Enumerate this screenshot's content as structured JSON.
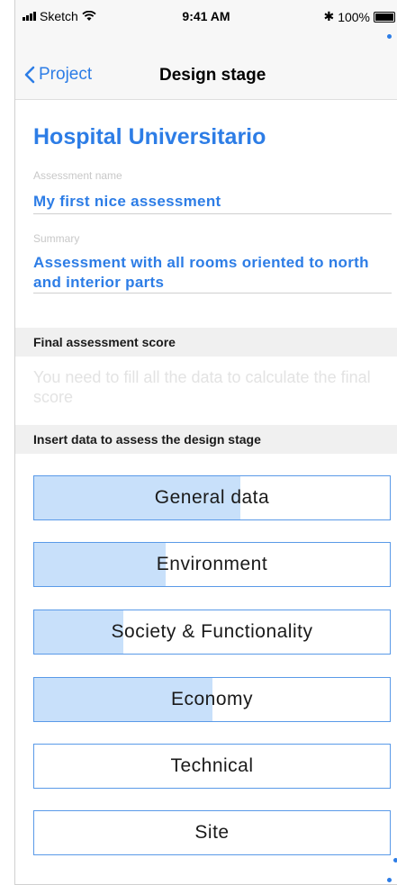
{
  "status_bar": {
    "carrier": "Sketch",
    "time": "9:41 AM",
    "bluetooth_symbol": "✱",
    "battery": "100%"
  },
  "nav": {
    "back_label": "Project",
    "title": "Design stage"
  },
  "project": {
    "name": "Hospital Universitario"
  },
  "fields": {
    "assessment_name_label": "Assessment name",
    "assessment_name_value": "My first nice assessment",
    "summary_label": "Summary",
    "summary_value": "Assessment with all rooms oriented to north and interior parts"
  },
  "sections": {
    "final_score_header": "Final assessment score",
    "final_score_placeholder": "You need to fill all the data to calculate the final score",
    "insert_data_header": "Insert data to assess the design stage"
  },
  "stages": [
    {
      "label": "General data",
      "progress": 0.58
    },
    {
      "label": "Environment",
      "progress": 0.37
    },
    {
      "label": "Society & Functionality",
      "progress": 0.25
    },
    {
      "label": "Economy",
      "progress": 0.5
    },
    {
      "label": "Technical",
      "progress": 0
    },
    {
      "label": "Site",
      "progress": 0
    }
  ],
  "colors": {
    "accent": "#2d7de6",
    "progress_fill": "#c8e0fa",
    "button_border": "#5a9ae8"
  },
  "icons": {
    "back": "chevron-left-icon",
    "signal": "signal-bars-icon",
    "wifi": "wifi-icon",
    "bluetooth": "bluetooth-icon",
    "battery": "battery-icon"
  }
}
